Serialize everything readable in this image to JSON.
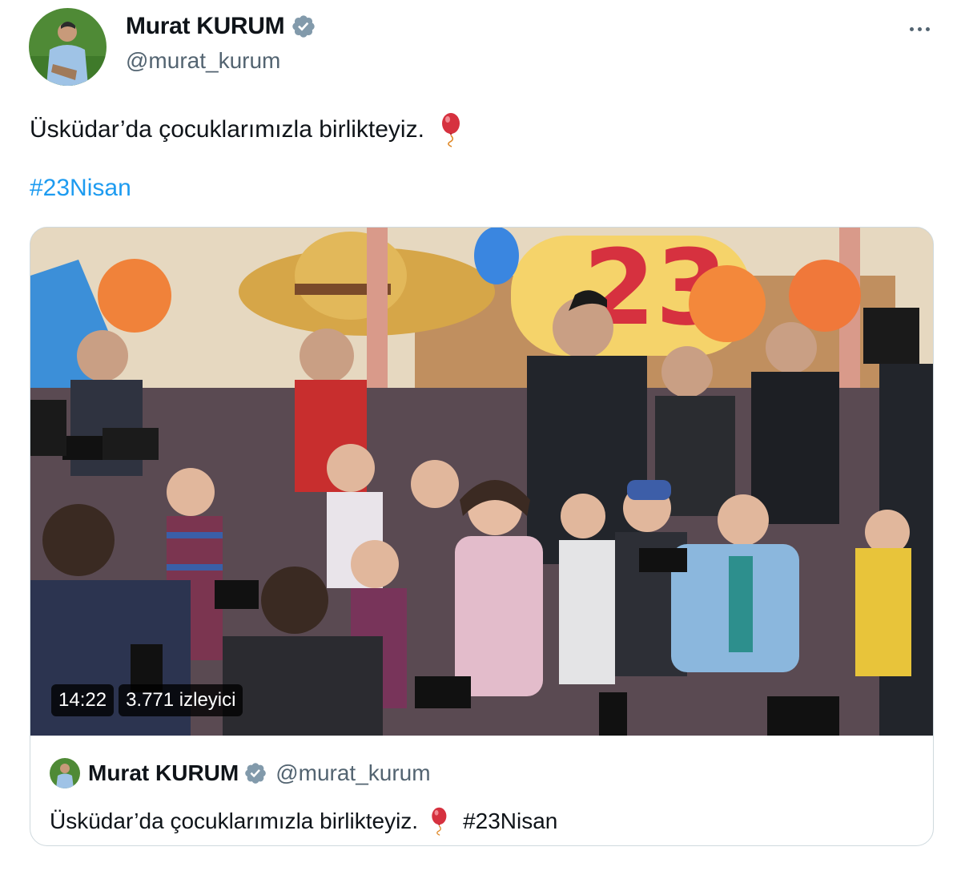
{
  "author": {
    "display_name": "Murat KURUM",
    "handle": "@murat_kurum",
    "verified_icon": "verified-badge-icon"
  },
  "tweet": {
    "text": "Üsküdar’da çocuklarımızla birlikteyiz.",
    "emoji_icon": "balloon-icon",
    "hashtag": "#23Nisan"
  },
  "media": {
    "duration": "14:22",
    "viewers": "3.771 izleyici"
  },
  "quote": {
    "display_name": "Murat KURUM",
    "handle": "@murat_kurum",
    "text": "Üsküdar’da çocuklarımızla birlikteyiz.",
    "hashtag": "#23Nisan"
  },
  "colors": {
    "link": "#1d9bf0",
    "secondary_text": "#536471",
    "border": "#cfd9de",
    "verified": "#829aab"
  }
}
